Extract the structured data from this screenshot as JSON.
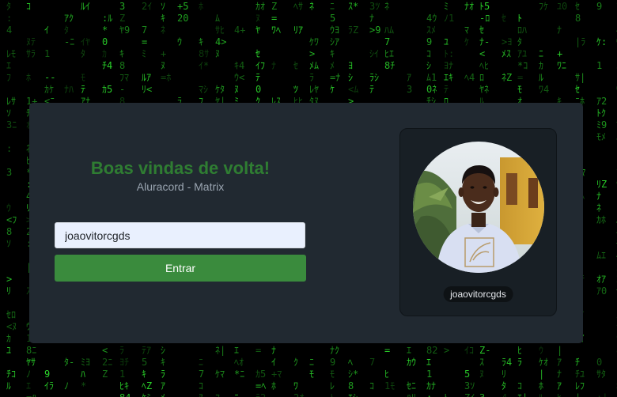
{
  "background": {
    "theme": "matrix-digital-rain",
    "rain_color": "#2bd62b",
    "base_color": "#000000"
  },
  "login": {
    "title": "Boas vindas de volta!",
    "subtitle": "Aluracord - Matrix",
    "username_value": "joaovitorcgds",
    "submit_label": "Entrar",
    "title_color": "#2f7d32",
    "button_color": "#3a8b3d"
  },
  "profile": {
    "username": "joaovitorcgds"
  }
}
